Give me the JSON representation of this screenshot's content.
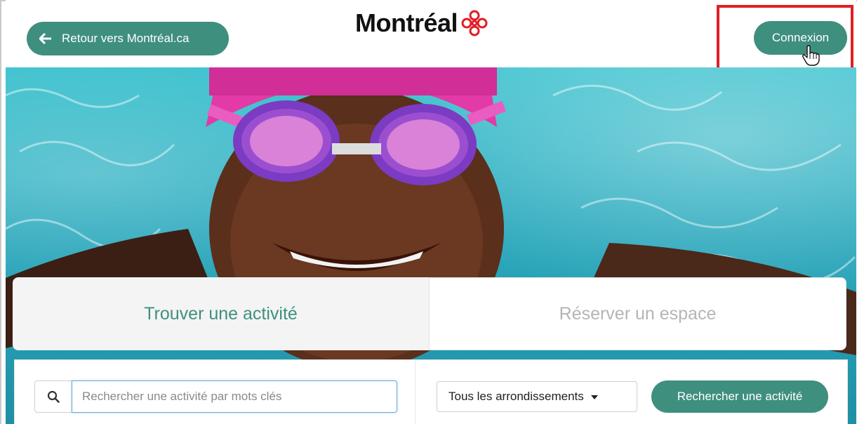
{
  "header": {
    "back_label": "Retour vers Montréal.ca",
    "logo_text": "Montréal",
    "login_label": "Connexion"
  },
  "tabs": [
    {
      "label": "Trouver une activité",
      "active": true
    },
    {
      "label": "Réserver un espace",
      "active": false
    }
  ],
  "search": {
    "placeholder": "Rechercher une activité par mots clés",
    "value": "",
    "district_selected": "Tous les arrondissements",
    "submit_label": "Rechercher une activité"
  },
  "colors": {
    "accent": "#3f8f7f",
    "highlight": "#e01f26",
    "inactive_tab_text": "#b5b5b5"
  },
  "icons": [
    "arrow-left-icon",
    "montreal-rosette-icon",
    "hand-cursor-icon",
    "search-icon",
    "caret-down-icon"
  ]
}
